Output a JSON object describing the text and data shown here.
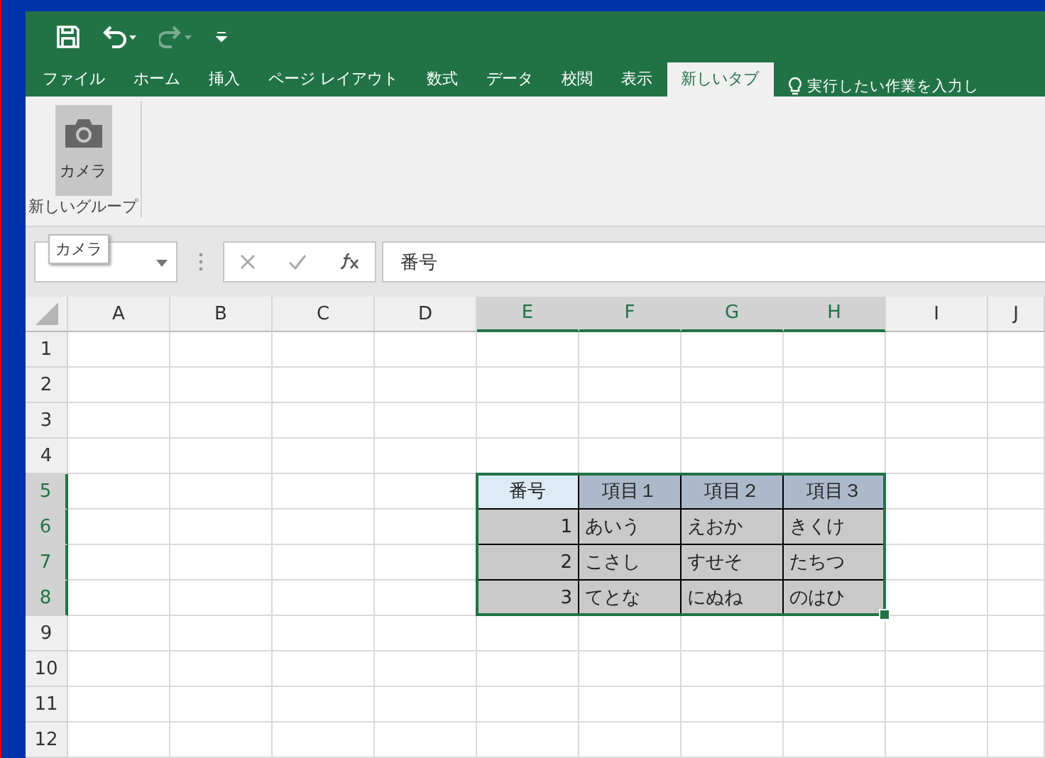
{
  "quick_access": [
    {
      "kind": "save",
      "disabled": false
    },
    {
      "kind": "undo",
      "disabled": false
    },
    {
      "kind": "redo",
      "disabled": true
    },
    {
      "kind": "customize",
      "disabled": false
    }
  ],
  "tabs": [
    {
      "label": "ファイル",
      "selected": false
    },
    {
      "label": "ホーム",
      "selected": false
    },
    {
      "label": "挿入",
      "selected": false
    },
    {
      "label": "ページ レイアウト",
      "selected": false
    },
    {
      "label": "数式",
      "selected": false
    },
    {
      "label": "データ",
      "selected": false
    },
    {
      "label": "校閲",
      "selected": false
    },
    {
      "label": "表示",
      "selected": false
    },
    {
      "label": "新しいタブ",
      "selected": true
    }
  ],
  "tell_me": {
    "placeholder": "実行したい作業を入力し"
  },
  "ribbon": {
    "groups": [
      {
        "label": "新しいグループ",
        "buttons": [
          {
            "label": "カメラ",
            "pressed": true
          }
        ]
      }
    ]
  },
  "tooltip": "カメラ",
  "formula_bar": {
    "formula": "番号"
  },
  "sheet": {
    "columns": [
      {
        "label": "A",
        "selected": false
      },
      {
        "label": "B",
        "selected": false
      },
      {
        "label": "C",
        "selected": false
      },
      {
        "label": "D",
        "selected": false
      },
      {
        "label": "E",
        "selected": true
      },
      {
        "label": "F",
        "selected": true
      },
      {
        "label": "G",
        "selected": true
      },
      {
        "label": "H",
        "selected": true
      },
      {
        "label": "I",
        "selected": false
      },
      {
        "label": "J",
        "selected": false
      }
    ],
    "rows": [
      {
        "label": "1",
        "selected": false
      },
      {
        "label": "2",
        "selected": false
      },
      {
        "label": "3",
        "selected": false
      },
      {
        "label": "4",
        "selected": false
      },
      {
        "label": "5",
        "selected": true
      },
      {
        "label": "6",
        "selected": true
      },
      {
        "label": "7",
        "selected": true
      },
      {
        "label": "8",
        "selected": true
      },
      {
        "label": "9",
        "selected": false
      },
      {
        "label": "10",
        "selected": false
      },
      {
        "label": "11",
        "selected": false
      },
      {
        "label": "12",
        "selected": false
      }
    ],
    "table": {
      "columns": [
        {
          "label": "番号",
          "kind": "number",
          "selected": true
        },
        {
          "label": "項目１",
          "kind": "text",
          "selected": false
        },
        {
          "label": "項目２",
          "kind": "text",
          "selected": false
        },
        {
          "label": "項目３",
          "kind": "text",
          "selected": false
        }
      ],
      "rows": [
        [
          "1",
          "あいう",
          "えおか",
          "きくけ"
        ],
        [
          "2",
          "こさし",
          "すせそ",
          "たちつ"
        ],
        [
          "3",
          "てとな",
          "にぬね",
          "のはひ"
        ]
      ]
    }
  }
}
